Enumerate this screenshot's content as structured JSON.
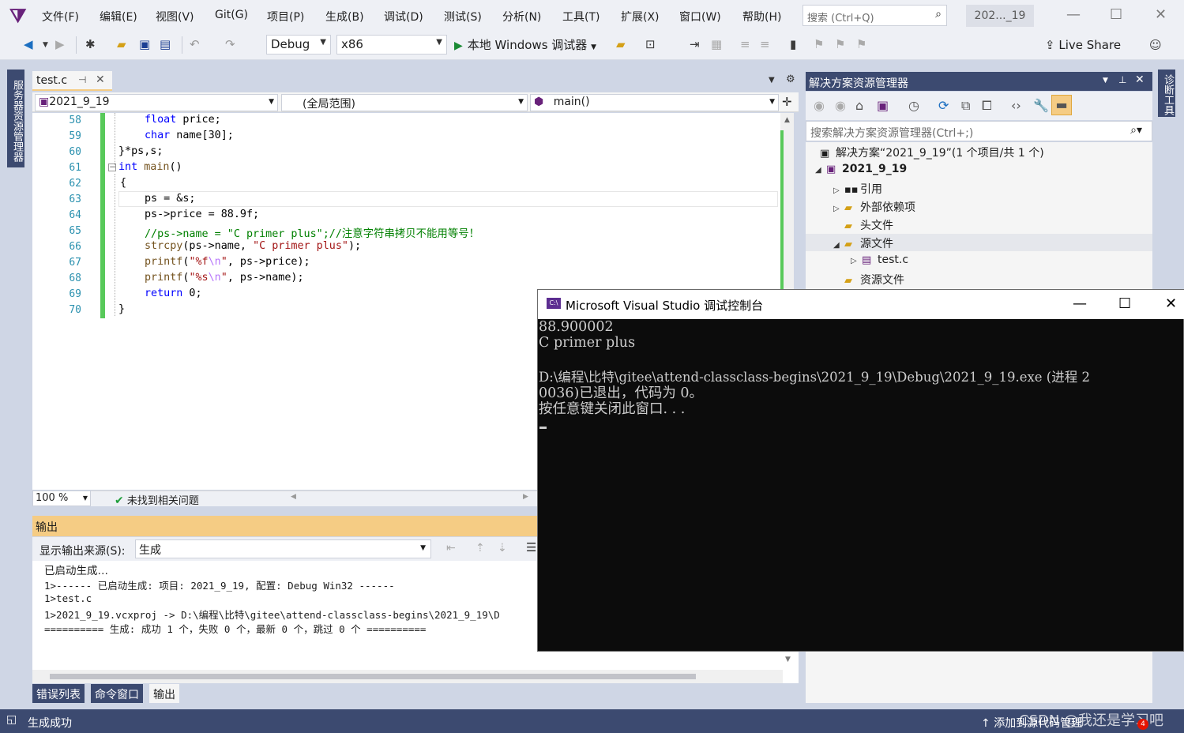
{
  "menu": {
    "items": [
      "文件(F)",
      "编辑(E)",
      "视图(V)",
      "Git(G)",
      "项目(P)",
      "生成(B)",
      "调试(D)",
      "测试(S)",
      "分析(N)",
      "工具(T)",
      "扩展(X)",
      "窗口(W)",
      "帮助(H)"
    ],
    "search_placeholder": "搜索 (Ctrl+Q)",
    "solution_badge": "202..._19"
  },
  "toolbar": {
    "config": "Debug",
    "platform": "x86",
    "run_label": "本地 Windows 调试器",
    "live_share": "Live Share"
  },
  "left_rail": {
    "label": "服务器资源管理器"
  },
  "right_rail": {
    "label": "诊断工具"
  },
  "editor": {
    "tab_name": "test.c",
    "nav_project": "2021_9_19",
    "nav_scope": "(全局范围)",
    "nav_member": "main()",
    "line_numbers": [
      "58",
      "59",
      "60",
      "61",
      "62",
      "63",
      "64",
      "65",
      "66",
      "67",
      "68",
      "69",
      "70"
    ],
    "zoom": "100 %",
    "issues": "未找到相关问题"
  },
  "output": {
    "title": "输出",
    "source_label": "显示输出来源(S):",
    "source_value": "生成",
    "lines": [
      "已启动生成…",
      "1>------ 已启动生成: 项目: 2021_9_19, 配置: Debug Win32 ------",
      "1>test.c",
      "1>2021_9_19.vcxproj -> D:\\编程\\比特\\gitee\\attend-classclass-begins\\2021_9_19\\D",
      "========== 生成: 成功 1 个，失败 0 个，最新 0 个，跳过 0 个 =========="
    ],
    "tabs": [
      "错误列表",
      "命令窗口",
      "输出"
    ]
  },
  "solution_explorer": {
    "title": "解决方案资源管理器",
    "search_placeholder": "搜索解决方案资源管理器(Ctrl+;)",
    "tree": [
      "解决方案“2021_9_19”(1 个项目/共 1 个)",
      "2021_9_19",
      "引用",
      "外部依赖项",
      "头文件",
      "源文件",
      "test.c",
      "资源文件"
    ]
  },
  "console": {
    "title": "Microsoft Visual Studio 调试控制台",
    "icon_text": "C:\\",
    "lines": [
      "88.900002",
      "C primer plus",
      "",
      "D:\\编程\\比特\\gitee\\attend-classclass-begins\\2021_9_19\\Debug\\2021_9_19.exe (进程 2",
      "0036)已退出，代码为 0。",
      "按任意键关闭此窗口. . ."
    ]
  },
  "status": {
    "left": "生成成功",
    "right": "添加到源代码管理",
    "watermark": "CSDN @我还是学习吧",
    "notifications": "4"
  },
  "colors": {
    "accent_dark": "#3c4a70",
    "output_header": "#f5cc84",
    "change_bar": "#58c95a",
    "keyword": "#0000ff",
    "string": "#a31515",
    "comment": "#008000"
  }
}
